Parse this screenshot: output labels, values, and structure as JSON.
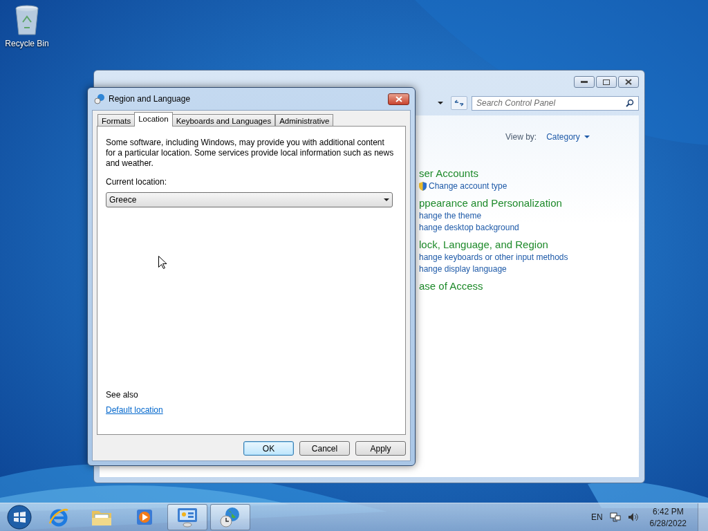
{
  "desktop": {
    "icons": [
      {
        "label": "Recycle Bin"
      }
    ]
  },
  "control_panel": {
    "search": {
      "placeholder": "Search Control Panel"
    },
    "view_by": {
      "label": "View by:",
      "value": "Category"
    },
    "categories": [
      {
        "title": "ser Accounts",
        "links": [
          {
            "text": "Change account type",
            "shield": true
          }
        ]
      },
      {
        "title": "ppearance and Personalization",
        "links": [
          {
            "text": "hange the theme",
            "shield": false
          },
          {
            "text": "hange desktop background",
            "shield": false
          }
        ]
      },
      {
        "title": "lock, Language, and Region",
        "links": [
          {
            "text": "hange keyboards or other input methods",
            "shield": false
          },
          {
            "text": "hange display language",
            "shield": false
          }
        ]
      },
      {
        "title": "ase of Access"
      }
    ]
  },
  "dialog": {
    "title": "Region and Language",
    "tabs": [
      {
        "label": "Formats",
        "selected": false
      },
      {
        "label": "Location",
        "selected": true
      },
      {
        "label": "Keyboards and Languages",
        "selected": false
      },
      {
        "label": "Administrative",
        "selected": false
      }
    ],
    "description": "Some software, including Windows, may provide you with additional content for a particular location. Some services provide local information such as news and weather.",
    "location_label": "Current location:",
    "location": "Greece",
    "see_also": "See also",
    "link": "Default location",
    "buttons": [
      {
        "label": "OK",
        "default": true
      },
      {
        "label": "Cancel",
        "default": false
      },
      {
        "label": "Apply",
        "default": false
      }
    ]
  },
  "taskbar": {
    "apps": [
      {
        "kind": "ie",
        "active": false
      },
      {
        "kind": "explorer",
        "active": false
      },
      {
        "kind": "media",
        "active": false
      },
      {
        "kind": "control",
        "active": true
      },
      {
        "kind": "region",
        "active": true
      }
    ],
    "language": "EN",
    "time": "6:42 PM",
    "date": "6/28/2022"
  }
}
